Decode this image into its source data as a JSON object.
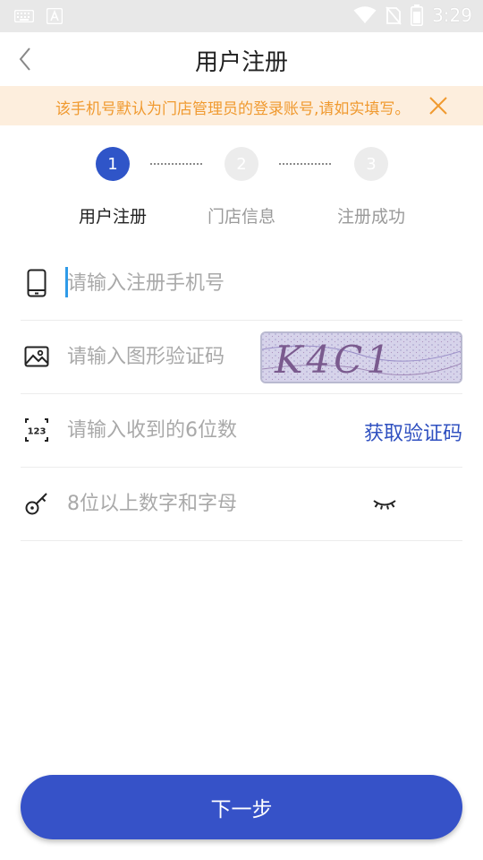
{
  "status_bar": {
    "time": "3:29"
  },
  "nav": {
    "title": "用户注册"
  },
  "notice": {
    "text": "该手机号默认为门店管理员的登录账号,请如实填写。"
  },
  "steps": [
    {
      "number": "1",
      "label": "用户注册",
      "active": true
    },
    {
      "number": "2",
      "label": "门店信息",
      "active": false
    },
    {
      "number": "3",
      "label": "注册成功",
      "active": false
    }
  ],
  "form": {
    "phone": {
      "placeholder": "请输入注册手机号",
      "value": ""
    },
    "captcha": {
      "placeholder": "请输入图形验证码",
      "value": "",
      "image_text": "K4C1"
    },
    "sms_code": {
      "placeholder": "请输入收到的6位数",
      "value": "",
      "get_code_label": "获取验证码"
    },
    "password": {
      "placeholder": "8位以上数字和字母",
      "value": ""
    }
  },
  "submit": {
    "label": "下一步"
  },
  "colors": {
    "primary": "#3652c8",
    "notice_bg": "#fdeedd",
    "notice_text": "#f09a30"
  }
}
